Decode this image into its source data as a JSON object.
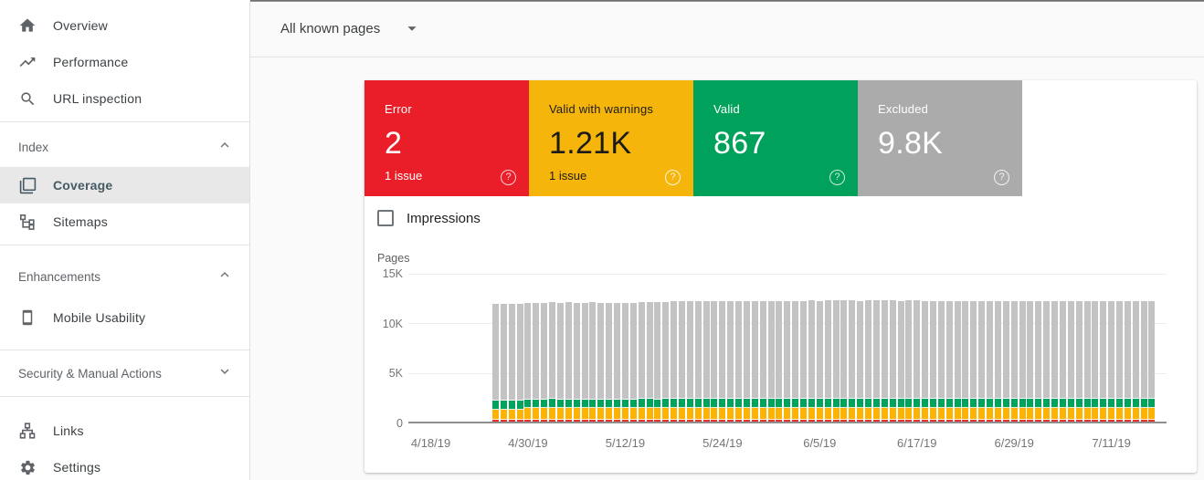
{
  "sidebar": {
    "items": {
      "overview": "Overview",
      "performance": "Performance",
      "url_inspection": "URL inspection",
      "coverage": "Coverage",
      "sitemaps": "Sitemaps",
      "mobile_usability": "Mobile Usability",
      "links": "Links",
      "settings": "Settings"
    },
    "sections": {
      "index": {
        "label": "Index",
        "expanded": true
      },
      "enhancements": {
        "label": "Enhancements",
        "expanded": true
      },
      "security": {
        "label": "Security & Manual Actions",
        "expanded": false
      }
    },
    "selected_item": "Coverage"
  },
  "topbar": {
    "page_filter": "All known pages"
  },
  "summary": {
    "help_icon": "?",
    "cards": [
      {
        "id": "error",
        "label": "Error",
        "value": "2",
        "sub": "1 issue",
        "bg": "#ea1e28",
        "text": "#ffffff",
        "help": "rgba(255,255,255,0.8)"
      },
      {
        "id": "valid-with-warnings",
        "label": "Valid with warnings",
        "value": "1.21K",
        "sub": "1 issue",
        "bg": "#f5b50a",
        "text": "#1b1b1b",
        "help": "rgba(255,255,255,0.85)"
      },
      {
        "id": "valid",
        "label": "Valid",
        "value": "867",
        "sub": "",
        "bg": "#00a25b",
        "text": "#ffffff",
        "help": "rgba(255,255,255,0.8)"
      },
      {
        "id": "excluded",
        "label": "Excluded",
        "value": "9.8K",
        "sub": "",
        "bg": "#ababab",
        "text": "#ffffff",
        "help": "rgba(255,255,255,0.85)"
      }
    ]
  },
  "controls": {
    "impressions_label": "Impressions",
    "impressions_checked": false
  },
  "chart_data": {
    "type": "bar",
    "stacked": true,
    "ylabel": "Pages",
    "ylim": [
      0,
      15000
    ],
    "grid": true,
    "legend": false,
    "y_ticks": [
      {
        "label": "0",
        "value": 0
      },
      {
        "label": "5K",
        "value": 5000
      },
      {
        "label": "10K",
        "value": 10000
      },
      {
        "label": "15K",
        "value": 15000
      }
    ],
    "x_ticks": [
      {
        "label": "4/18/19",
        "day": -8
      },
      {
        "label": "4/30/19",
        "day": 4
      },
      {
        "label": "5/12/19",
        "day": 16
      },
      {
        "label": "5/24/19",
        "day": 28
      },
      {
        "label": "6/5/19",
        "day": 40
      },
      {
        "label": "6/17/19",
        "day": 52
      },
      {
        "label": "6/29/19",
        "day": 64
      },
      {
        "label": "7/11/19",
        "day": 76
      }
    ],
    "dates": [
      "4/26/19",
      "4/27/19",
      "4/28/19",
      "4/29/19",
      "4/30/19",
      "5/1/19",
      "5/2/19",
      "5/3/19",
      "5/4/19",
      "5/5/19",
      "5/6/19",
      "5/7/19",
      "5/8/19",
      "5/9/19",
      "5/10/19",
      "5/11/19",
      "5/12/19",
      "5/13/19",
      "5/14/19",
      "5/15/19",
      "5/16/19",
      "5/17/19",
      "5/18/19",
      "5/19/19",
      "5/20/19",
      "5/21/19",
      "5/22/19",
      "5/23/19",
      "5/24/19",
      "5/25/19",
      "5/26/19",
      "5/27/19",
      "5/28/19",
      "5/29/19",
      "5/30/19",
      "5/31/19",
      "6/1/19",
      "6/2/19",
      "6/3/19",
      "6/4/19",
      "6/5/19",
      "6/6/19",
      "6/7/19",
      "6/8/19",
      "6/9/19",
      "6/10/19",
      "6/11/19",
      "6/12/19",
      "6/13/19",
      "6/14/19",
      "6/15/19",
      "6/16/19",
      "6/17/19",
      "6/18/19",
      "6/19/19",
      "6/20/19",
      "6/21/19",
      "6/22/19",
      "6/23/19",
      "6/24/19",
      "6/25/19",
      "6/26/19",
      "6/27/19",
      "6/28/19",
      "6/29/19",
      "6/30/19",
      "7/1/19",
      "7/2/19",
      "7/3/19",
      "7/4/19",
      "7/5/19",
      "7/6/19",
      "7/7/19",
      "7/8/19",
      "7/9/19",
      "7/10/19",
      "7/11/19",
      "7/12/19",
      "7/13/19",
      "7/14/19",
      "7/15/19",
      "7/16/19"
    ],
    "series": [
      {
        "key": "error",
        "name": "Error",
        "color": "#e5352b",
        "values": [
          2,
          2,
          2,
          2,
          2,
          2,
          2,
          2,
          2,
          2,
          2,
          2,
          2,
          2,
          2,
          2,
          2,
          2,
          2,
          2,
          2,
          2,
          2,
          2,
          2,
          2,
          2,
          2,
          2,
          2,
          2,
          2,
          2,
          2,
          2,
          2,
          2,
          2,
          2,
          2,
          2,
          2,
          2,
          2,
          2,
          2,
          2,
          2,
          2,
          2,
          2,
          2,
          2,
          2,
          2,
          2,
          2,
          2,
          2,
          2,
          2,
          2,
          2,
          2,
          2,
          2,
          2,
          2,
          2,
          2,
          2,
          2,
          2,
          2,
          2,
          2,
          2,
          2,
          2,
          2,
          2,
          2
        ]
      },
      {
        "key": "warnings",
        "name": "Valid with warnings",
        "color": "#fcb303",
        "values": [
          1048,
          1052,
          1050,
          1046,
          1192,
          1196,
          1190,
          1198,
          1194,
          1197,
          1193,
          1190,
          1196,
          1194,
          1192,
          1189,
          1195,
          1193,
          1197,
          1200,
          1196,
          1198,
          1202,
          1204,
          1200,
          1203,
          1201,
          1205,
          1202,
          1200,
          1204,
          1207,
          1203,
          1206,
          1202,
          1205,
          1208,
          1204,
          1207,
          1210,
          1207,
          1212,
          1209,
          1214,
          1211,
          1208,
          1213,
          1210,
          1215,
          1212,
          1209,
          1214,
          1217,
          1220,
          1218,
          1222,
          1219,
          1223,
          1220,
          1217,
          1221,
          1219,
          1224,
          1220,
          1222,
          1218,
          1221,
          1223,
          1219,
          1220,
          1222,
          1217,
          1223,
          1220,
          1218,
          1222,
          1219,
          1221,
          1220,
          1223,
          1217,
          1210
        ]
      },
      {
        "key": "valid",
        "name": "Valid",
        "color": "#00a35c",
        "values": [
          842,
          846,
          850,
          845,
          858,
          862,
          859,
          864,
          860,
          863,
          861,
          858,
          864,
          862,
          860,
          857,
          863,
          861,
          865,
          868,
          864,
          866,
          870,
          872,
          868,
          871,
          869,
          873,
          870,
          868,
          872,
          875,
          871,
          874,
          870,
          873,
          876,
          872,
          875,
          878,
          875,
          880,
          877,
          882,
          879,
          876,
          881,
          878,
          883,
          880,
          877,
          882,
          885,
          892,
          898,
          902,
          899,
          903,
          900,
          897,
          901,
          899,
          904,
          900,
          902,
          898,
          901,
          903,
          899,
          900,
          902,
          897,
          903,
          900,
          898,
          902,
          899,
          901,
          900,
          903,
          897,
          867
        ]
      },
      {
        "key": "excluded",
        "name": "Excluded",
        "color": "#c3c3c3",
        "values": [
          9705,
          9712,
          9700,
          9708,
          9690,
          9695,
          9688,
          9700,
          9692,
          9698,
          9685,
          9690,
          9702,
          9694,
          9688,
          9692,
          9696,
          9690,
          9700,
          9705,
          9698,
          9702,
          9780,
          9788,
          9782,
          9790,
          9785,
          9792,
          9786,
          9780,
          9795,
          9800,
          9788,
          9798,
          9790,
          9795,
          9805,
          9798,
          9850,
          9858,
          9852,
          9862,
          9855,
          9865,
          9858,
          9852,
          9860,
          9856,
          9868,
          9862,
          9850,
          9855,
          9840,
          9780,
          9745,
          9752,
          9740,
          9755,
          9748,
          9738,
          9750,
          9742,
          9758,
          9746,
          9750,
          9740,
          9748,
          9754,
          9742,
          9745,
          9752,
          9738,
          9755,
          9744,
          9742,
          9750,
          9745,
          9748,
          9740,
          9752,
          9736,
          9800
        ]
      }
    ]
  }
}
